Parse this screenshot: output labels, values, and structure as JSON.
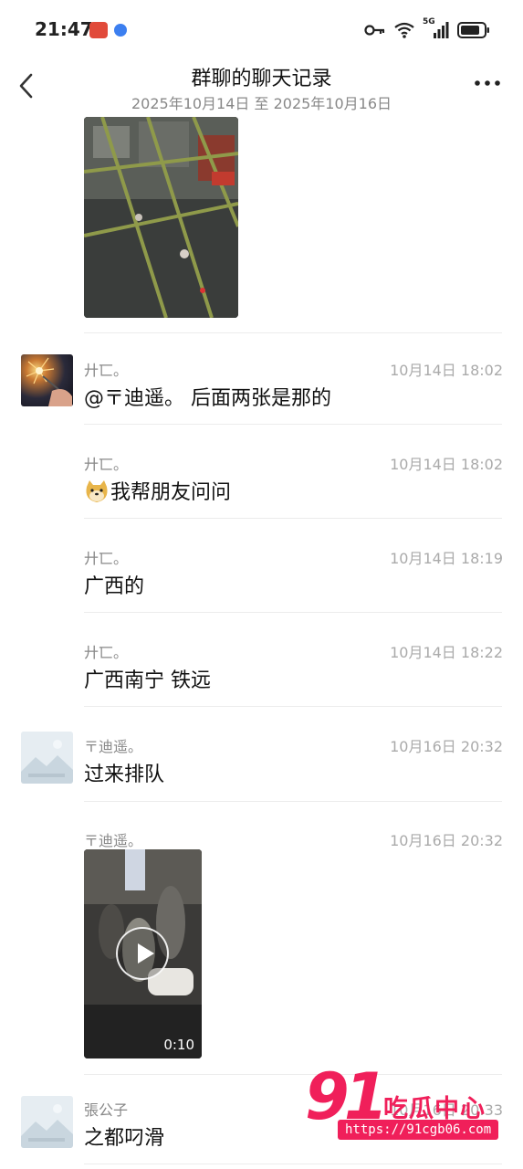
{
  "status_bar": {
    "time": "21:47",
    "network": "5G",
    "icons": [
      "vpn-key-icon",
      "wifi-icon",
      "cellular-signal-icon",
      "battery-icon"
    ]
  },
  "header": {
    "title": "群聊的聊天记录",
    "date_range": "2025年10月14日 至 2025年10月16日"
  },
  "messages": [
    {
      "sender": "廾匸。",
      "time": "10月14日 18:02",
      "text": "@〒迪遥。 后面两张是那的",
      "avatar": "sparkler-photo"
    },
    {
      "sender": "廾匸。",
      "time": "10月14日 18:02",
      "text": "我帮朋友问问",
      "emoji": "doge-face-icon"
    },
    {
      "sender": "廾匸。",
      "time": "10月14日 18:19",
      "text": "广西的"
    },
    {
      "sender": "廾匸。",
      "time": "10月14日 18:22",
      "text": "广西南宁 铁远"
    },
    {
      "sender": "〒迪遥。",
      "time": "10月16日 20:32",
      "text": "过来排队",
      "avatar": "default"
    },
    {
      "sender": "〒迪遥。",
      "time": "10月16日 20:32",
      "video_duration": "0:10"
    },
    {
      "sender": "張公子",
      "time": "10月16日 20:33",
      "text": "之都叼滑",
      "avatar": "default"
    }
  ],
  "watermark": {
    "logo": "91",
    "name": "吃瓜中心",
    "url": "https://91cgb06.com"
  },
  "colors": {
    "watermark": "#f01f5a",
    "meta_text": "#888888",
    "divider": "#ececec"
  }
}
